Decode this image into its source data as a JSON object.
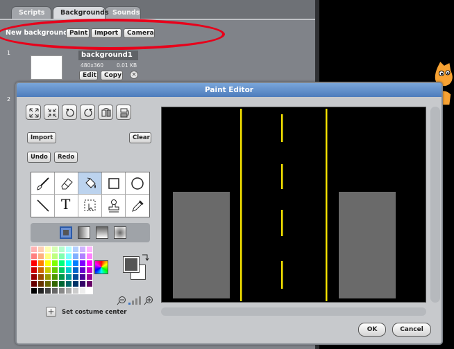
{
  "scratch": {
    "tabs": [
      {
        "label": "Scripts"
      },
      {
        "label": "Backgrounds"
      },
      {
        "label": "Sounds"
      }
    ],
    "new_background_label": "New background:",
    "paint_label": "Paint",
    "import_label": "Import",
    "camera_label": "Camera",
    "backgrounds": [
      {
        "index": "1",
        "name": "background1",
        "dimensions": "480x360",
        "size": "0.01 KB",
        "edit_label": "Edit",
        "copy_label": "Copy"
      },
      {
        "index": "2"
      }
    ]
  },
  "paint_editor": {
    "title": "Paint Editor",
    "import_label": "Import",
    "clear_label": "Clear",
    "undo_label": "Undo",
    "redo_label": "Redo",
    "text_tool_glyph": "T",
    "set_costume_center_label": "Set costume center",
    "ok_label": "OK",
    "cancel_label": "Cancel",
    "tools": [
      "paintbrush",
      "eraser",
      "fill",
      "rectangle",
      "ellipse",
      "line",
      "text",
      "select",
      "stamp",
      "eyedropper"
    ],
    "selected_tool": "fill",
    "foreground_color": "#555555",
    "background_color": "#ffffff",
    "palette": [
      "#ffb3b3",
      "#ffcfb3",
      "#ffffb3",
      "#d6ffb3",
      "#b3ffcf",
      "#b3ffff",
      "#b3cfff",
      "#cfb3ff",
      "#ffb3ff",
      "#ff8080",
      "#ffb080",
      "#ffff80",
      "#c0ff80",
      "#80ffb0",
      "#80ffff",
      "#80b0ff",
      "#b080ff",
      "#ff80ff",
      "#ff0000",
      "#ff7f00",
      "#ffff00",
      "#80ff00",
      "#00ff7f",
      "#00ffff",
      "#0080ff",
      "#8000ff",
      "#ff00ff",
      "#cc0000",
      "#cc6600",
      "#cccc00",
      "#66cc00",
      "#00cc66",
      "#00cccc",
      "#0066cc",
      "#6600cc",
      "#cc00cc",
      "#990000",
      "#994c00",
      "#999900",
      "#4c9900",
      "#00994c",
      "#009999",
      "#004c99",
      "#4c0099",
      "#990099",
      "#660000",
      "#663300",
      "#666600",
      "#336600",
      "#006633",
      "#006666",
      "#003366",
      "#330066",
      "#660066",
      "#000000",
      "#222222",
      "#444444",
      "#666666",
      "#888888",
      "#aaaaaa",
      "#cccccc",
      "#eeeeee",
      "#ffffff"
    ]
  }
}
